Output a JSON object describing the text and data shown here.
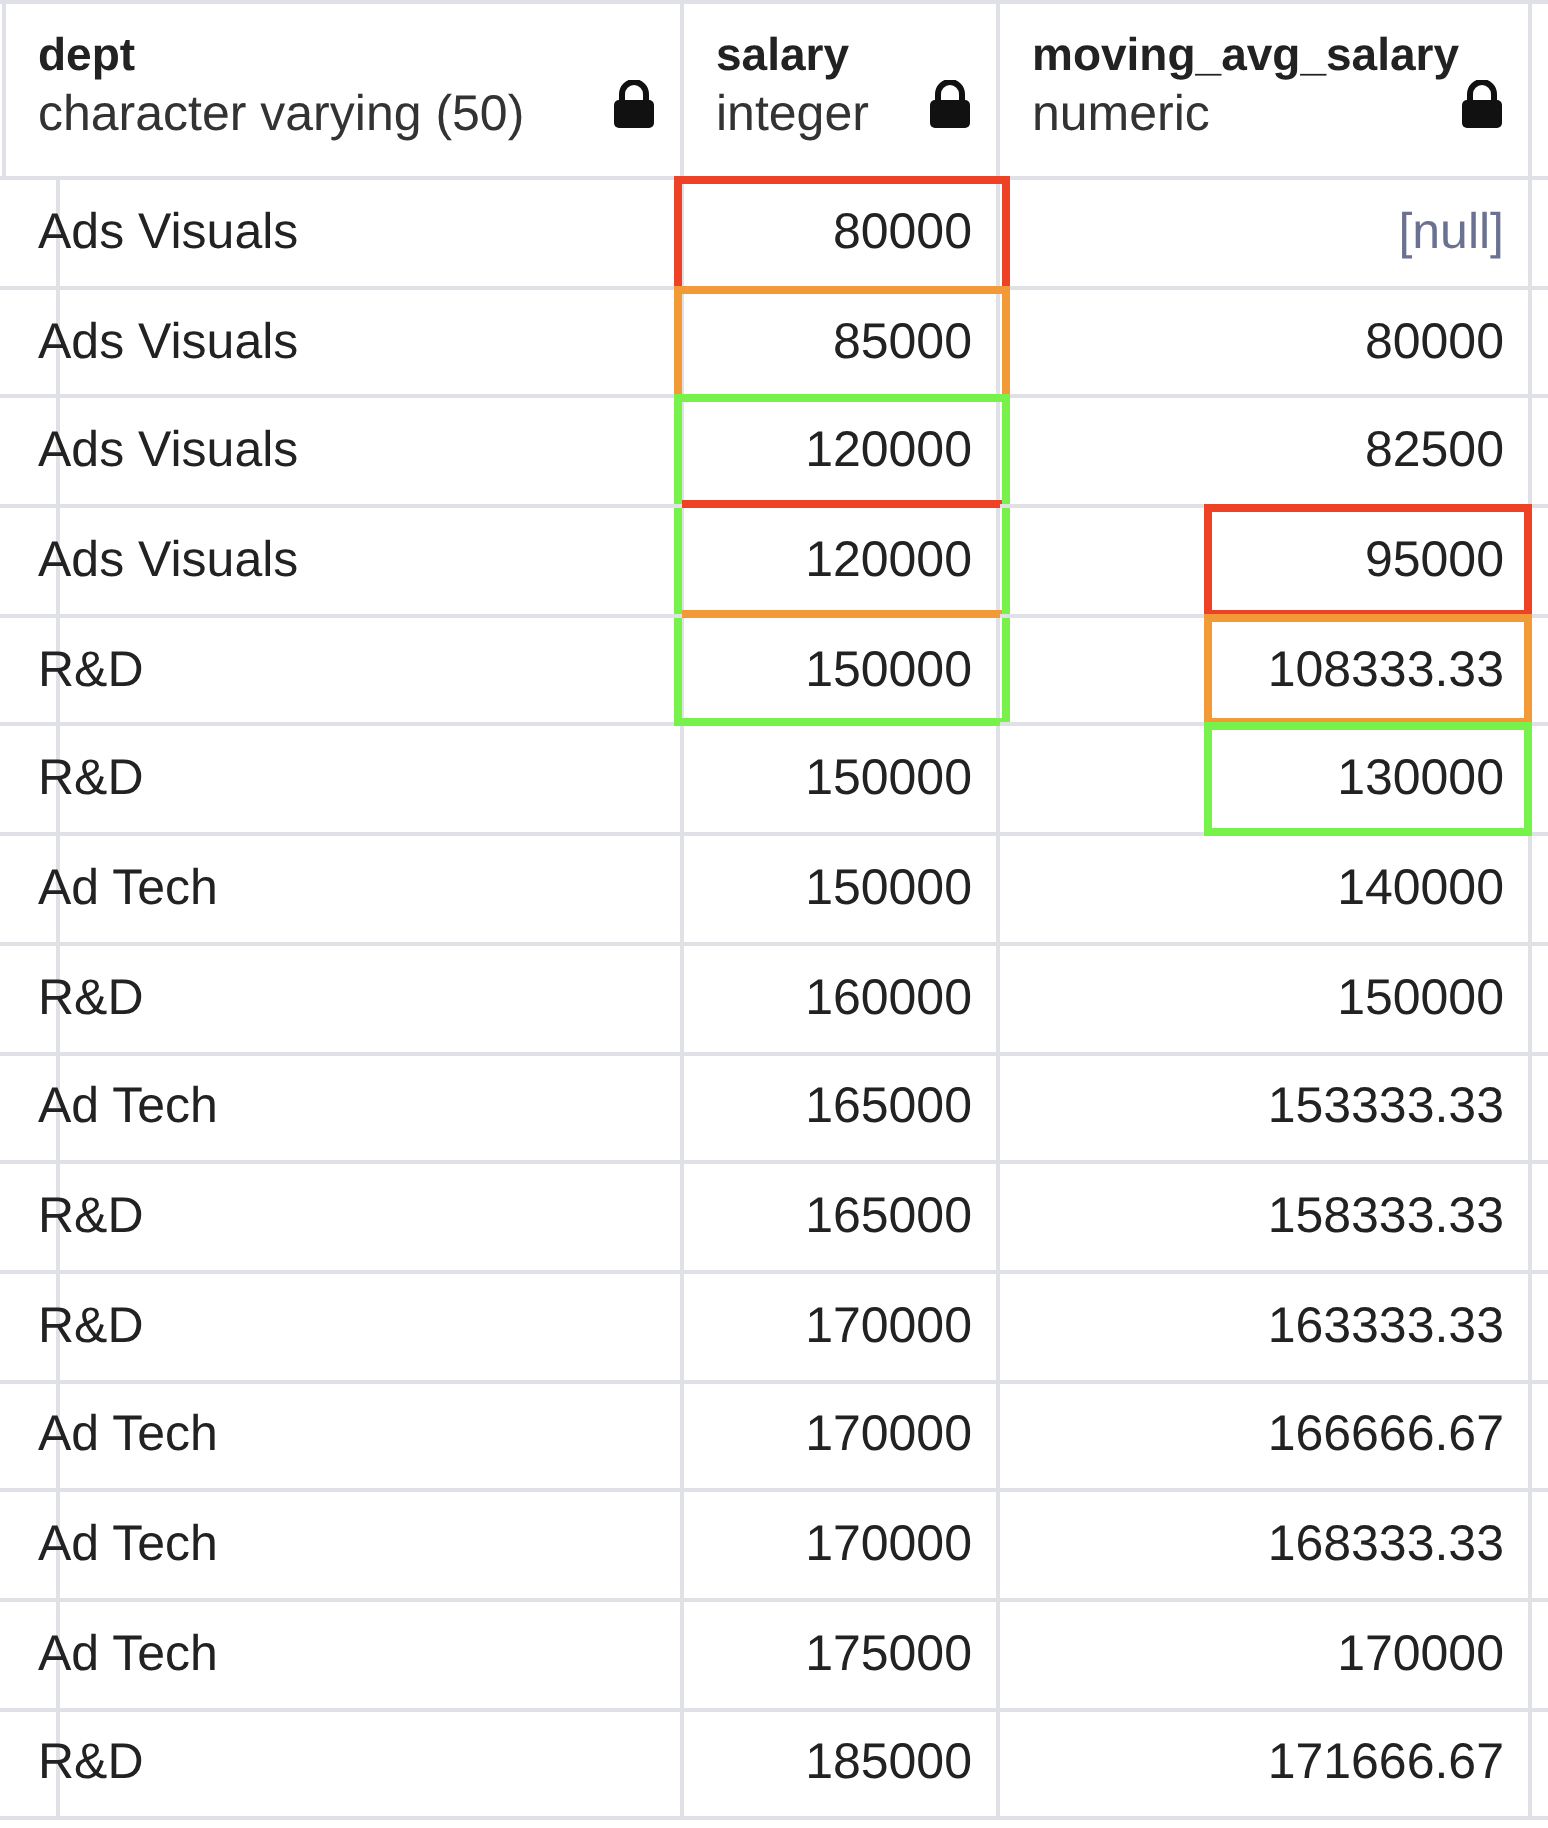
{
  "columns": [
    {
      "name": "dept",
      "type": "character varying (50)",
      "locked": true
    },
    {
      "name": "salary",
      "type": "integer",
      "locked": true
    },
    {
      "name": "moving_avg_salary",
      "type": "numeric",
      "locked": true
    }
  ],
  "rows": [
    {
      "dept": "Ads Visuals",
      "salary": "80000",
      "moving_avg_salary": "[null]",
      "avg_null": true,
      "frames": [
        {
          "kind": "salary",
          "color": "#ee4227",
          "top": true,
          "bottom": false
        }
      ]
    },
    {
      "dept": "Ads Visuals",
      "salary": "85000",
      "moving_avg_salary": "80000",
      "avg_null": false,
      "frames": [
        {
          "kind": "salary",
          "color": "#f39a38",
          "top": true,
          "bottom": false
        }
      ]
    },
    {
      "dept": "Ads Visuals",
      "salary": "120000",
      "moving_avg_salary": "82500",
      "avg_null": false,
      "frames": [
        {
          "kind": "salary",
          "color": "#77f24a",
          "top": true,
          "bottom": false
        },
        {
          "kind": "salary_end",
          "color": "#ee4227"
        }
      ]
    },
    {
      "dept": "Ads Visuals",
      "salary": "120000",
      "moving_avg_salary": "95000",
      "avg_null": false,
      "frames": [
        {
          "kind": "salary",
          "color": "#77f24a",
          "top": false,
          "bottom": false
        },
        {
          "kind": "salary_end",
          "color": "#f39a38"
        },
        {
          "kind": "average",
          "color": "#ee4227"
        }
      ]
    },
    {
      "dept": "R&D",
      "salary": "150000",
      "moving_avg_salary": "108333.33",
      "avg_null": false,
      "frames": [
        {
          "kind": "salary",
          "color": "#77f24a",
          "top": false,
          "bottom": true
        },
        {
          "kind": "average",
          "color": "#f39a38"
        }
      ]
    },
    {
      "dept": "R&D",
      "salary": "150000",
      "moving_avg_salary": "130000",
      "avg_null": false,
      "frames": [
        {
          "kind": "average",
          "color": "#77f24a"
        }
      ]
    },
    {
      "dept": "Ad Tech",
      "salary": "150000",
      "moving_avg_salary": "140000",
      "avg_null": false
    },
    {
      "dept": "R&D",
      "salary": "160000",
      "moving_avg_salary": "150000",
      "avg_null": false
    },
    {
      "dept": "Ad Tech",
      "salary": "165000",
      "moving_avg_salary": "153333.33",
      "avg_null": false
    },
    {
      "dept": "R&D",
      "salary": "165000",
      "moving_avg_salary": "158333.33",
      "avg_null": false
    },
    {
      "dept": "R&D",
      "salary": "170000",
      "moving_avg_salary": "163333.33",
      "avg_null": false
    },
    {
      "dept": "Ad Tech",
      "salary": "170000",
      "moving_avg_salary": "166666.67",
      "avg_null": false
    },
    {
      "dept": "Ad Tech",
      "salary": "170000",
      "moving_avg_salary": "168333.33",
      "avg_null": false
    },
    {
      "dept": "Ad Tech",
      "salary": "175000",
      "moving_avg_salary": "170000",
      "avg_null": false
    },
    {
      "dept": "R&D",
      "salary": "185000",
      "moving_avg_salary": "171666.67",
      "avg_null": false
    }
  ]
}
